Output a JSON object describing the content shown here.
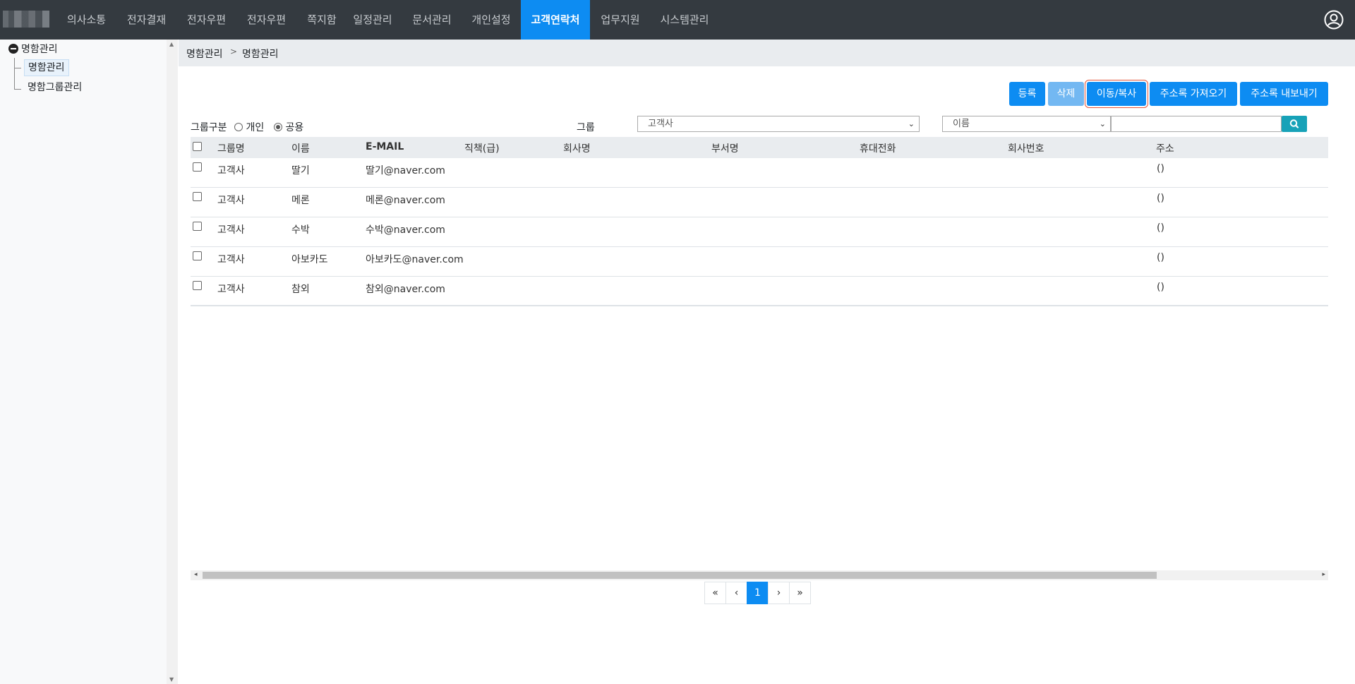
{
  "nav": {
    "items": [
      {
        "label": "의사소통",
        "active": false
      },
      {
        "label": "전자결재",
        "active": false
      },
      {
        "label": "전자우편",
        "active": false
      },
      {
        "label": "전자우편",
        "active": false
      },
      {
        "label": "쪽지함",
        "active": false
      },
      {
        "label": "일정관리",
        "active": false
      },
      {
        "label": "문서관리",
        "active": false
      },
      {
        "label": "개인설정",
        "active": false
      },
      {
        "label": "고객연락처",
        "active": true
      },
      {
        "label": "업무지원",
        "active": false
      },
      {
        "label": "시스템관리",
        "active": false
      }
    ],
    "profile_icon": "user-circle-icon",
    "active_color": "#0d8cf2"
  },
  "sidebar": {
    "root_label": "명함관리",
    "items": [
      {
        "label": "명함관리",
        "selected": true
      },
      {
        "label": "명함그룹관리",
        "selected": false
      }
    ]
  },
  "breadcrumb": {
    "items": [
      "명함관리",
      "명함관리"
    ],
    "separator": ">"
  },
  "toolbar": {
    "register": "등록",
    "delete": "삭제",
    "move_copy": "이동/복사",
    "import": "주소록 가져오기",
    "export": "주소록 내보내기"
  },
  "filters": {
    "group_type_label": "그룹구분",
    "option_private": "개인",
    "option_public": "공용",
    "selected_option": "공용",
    "group_label": "그룹",
    "group_select_value": "고객사",
    "field_select_value": "이름",
    "search_value": "",
    "search_icon": "search-icon"
  },
  "table": {
    "headers": [
      "그룹명",
      "이름",
      "E-MAIL",
      "직책(급)",
      "회사명",
      "부서명",
      "휴대전화",
      "회사번호",
      "주소"
    ],
    "rows": [
      {
        "group": "고객사",
        "name": "딸기",
        "email": "딸기@naver.com",
        "title": "",
        "company": "",
        "dept": "",
        "mobile": "",
        "phone": "",
        "address": "()"
      },
      {
        "group": "고객사",
        "name": "메론",
        "email": "메론@naver.com",
        "title": "",
        "company": "",
        "dept": "",
        "mobile": "",
        "phone": "",
        "address": "()"
      },
      {
        "group": "고객사",
        "name": "수박",
        "email": "수박@naver.com",
        "title": "",
        "company": "",
        "dept": "",
        "mobile": "",
        "phone": "",
        "address": "()"
      },
      {
        "group": "고객사",
        "name": "아보카도",
        "email": "아보카도@naver.com",
        "title": "",
        "company": "",
        "dept": "",
        "mobile": "",
        "phone": "",
        "address": "()"
      },
      {
        "group": "고객사",
        "name": "참외",
        "email": "참외@naver.com",
        "title": "",
        "company": "",
        "dept": "",
        "mobile": "",
        "phone": "",
        "address": "()"
      }
    ]
  },
  "pagination": {
    "first": "«",
    "prev": "‹",
    "current": "1",
    "next": "›",
    "last": "»"
  }
}
